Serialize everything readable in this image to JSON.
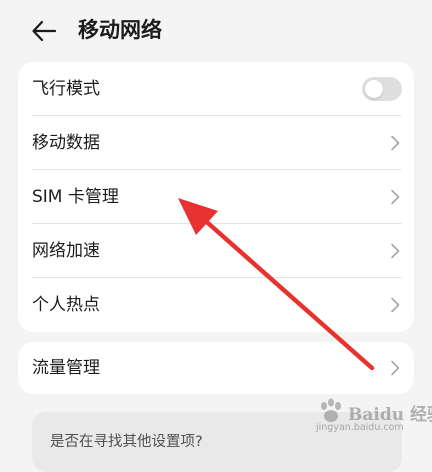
{
  "header": {
    "back_icon": "arrow-left-icon",
    "title": "移动网络"
  },
  "settings": {
    "items": [
      {
        "label": "飞行模式",
        "control": "toggle",
        "toggle_on": false
      },
      {
        "label": "移动数据",
        "control": "chevron"
      },
      {
        "label": "SIM 卡管理",
        "control": "chevron"
      },
      {
        "label": "网络加速",
        "control": "chevron"
      },
      {
        "label": "个人热点",
        "control": "chevron"
      }
    ]
  },
  "traffic": {
    "label": "流量管理",
    "control": "chevron"
  },
  "suggestion": {
    "text": "是否在寻找其他设置项?"
  },
  "annotation": {
    "arrow_color": "#e8322f",
    "points_to": "SIM 卡管理"
  },
  "watermark": {
    "brand": "Baidu 经验",
    "sub": "jingyan.baidu.com"
  },
  "colors": {
    "background": "#f4f4f4",
    "card": "#ffffff",
    "toggle_off": "#dedede",
    "chevron": "#a6a6a6"
  }
}
